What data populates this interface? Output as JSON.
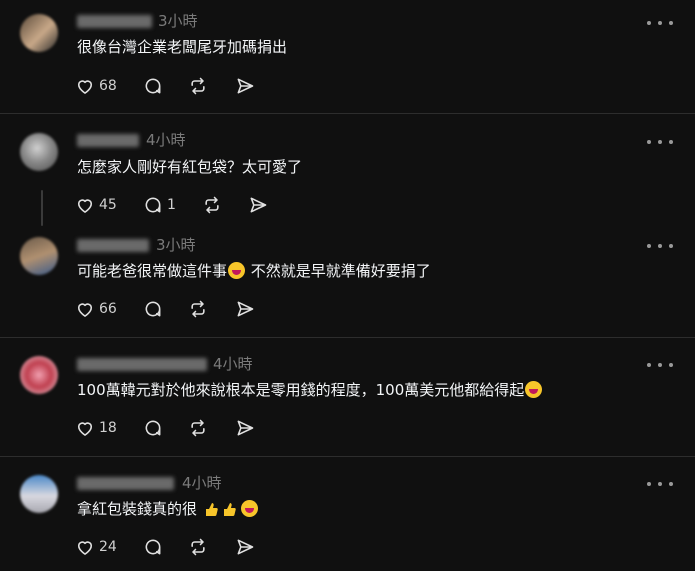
{
  "comments": [
    {
      "time": "3小時",
      "text": "很像台灣企業老闆尾牙加碼捐出",
      "likes": "68",
      "replies": "",
      "avatar_colors": [
        "#5a4a3a",
        "#c8a888",
        "#2a2a2a"
      ]
    },
    {
      "time": "4小時",
      "text": "怎麼家人剛好有紅包袋？太可愛了",
      "likes": "45",
      "replies": "1",
      "avatar_colors": [
        "#8a8a8a",
        "#d0d0d0",
        "#4a4a4a"
      ]
    },
    {
      "time": "3小時",
      "text_before": "可能老爸很常做這件事",
      "text_after": " 不然就是早就準備好要捐了",
      "likes": "66",
      "replies": "",
      "avatar_colors": [
        "#6a5a4a",
        "#b09070",
        "#3a5a8a"
      ]
    },
    {
      "time": "4小時",
      "text_before": "100萬韓元對於他來說根本是零用錢的程度，100萬美元他都給得起",
      "likes": "18",
      "replies": "",
      "avatar_colors": [
        "#c04050",
        "#f0a0b0",
        "#e8d0d8"
      ]
    },
    {
      "time": "4小時",
      "text_before": "拿紅包裝錢真的很",
      "likes": "24",
      "replies": "",
      "avatar_colors": [
        "#4a88c8",
        "#d8d8e0",
        "#a8a8b0"
      ]
    }
  ],
  "icons": {
    "like": "heart-icon",
    "reply": "comment-icon",
    "repost": "repost-icon",
    "share": "send-icon",
    "more": "more-dots-icon"
  }
}
